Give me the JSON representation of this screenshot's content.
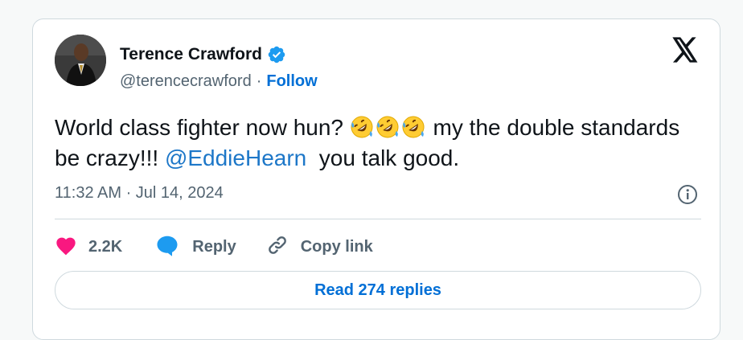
{
  "tweet": {
    "author_name": "Terence Crawford",
    "handle": "@terencecrawford",
    "separator": "·",
    "follow_label": "Follow",
    "text_part1": "World class fighter now hun? ",
    "text_emojis": [
      "rolling-on-floor-laughing",
      "rolling-on-floor-laughing",
      "rolling-on-floor-laughing"
    ],
    "text_part2": " my the double standards be crazy!!! ",
    "mention": "@EddieHearn",
    "text_part3": "  you talk good.",
    "timestamp": "11:32 AM · Jul 14, 2024"
  },
  "actions": {
    "like_count": "2.2K",
    "reply_label": "Reply",
    "copy_link_label": "Copy link"
  },
  "read_replies_label": "Read 274 replies",
  "colors": {
    "accent_blue": "#006fd6",
    "mention_blue": "#1d77c8",
    "heart_pink": "#f91880",
    "verified_blue": "#1d9bf0",
    "text_secondary": "#536471"
  }
}
